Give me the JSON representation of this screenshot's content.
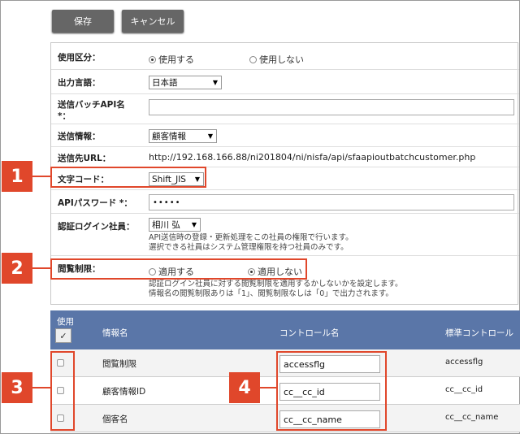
{
  "toolbar": {
    "save_label": "保存",
    "cancel_label": "キャンセル"
  },
  "form": {
    "usage": {
      "label": "使用区分：",
      "options": [
        "使用する",
        "使用しない"
      ],
      "selected": "使用する"
    },
    "language": {
      "label": "出力言語：",
      "value": "日本語"
    },
    "batch_api": {
      "label_line1": "送信バッチAPI名",
      "label_line2": "*：",
      "value": ""
    },
    "send_info": {
      "label": "送信情報：",
      "value": "顧客情報"
    },
    "url": {
      "label": "送信先URL：",
      "value": "http://192.168.166.88/ni201804/ni/nisfa/api/sfaapioutbatchcustomer.php"
    },
    "charset": {
      "label": "文字コード：",
      "value": "Shift_JIS"
    },
    "api_password": {
      "label": "APIパスワード *：",
      "value": "•••••"
    },
    "auth_user": {
      "label": "認証ログイン社員：",
      "value": "相川 弘",
      "note_line1": "API送信時の登録・更新処理をこの社員の権限で行います。",
      "note_line2": "選択できる社員はシステム管理権限を持つ社員のみです。"
    },
    "view_restrict": {
      "label": "閲覧制限：",
      "options": [
        "適用する",
        "適用しない"
      ],
      "selected": "適用しない",
      "note_line1": "認証ログイン社員に対する閲覧制限を適用するかしないかを設定します。",
      "note_line2": "情報名の閲覧制限ありは「1」、閲覧制限なしは「0」で出力されます。"
    }
  },
  "table": {
    "headers": {
      "use": "使用",
      "info_name": "情報名",
      "control_name": "コントロール名",
      "std_control": "標準コントロール"
    },
    "checkall_glyph": "✓",
    "rows": [
      {
        "info_name": "閲覧制限",
        "control_name": "accessflg",
        "std_control": "accessflg"
      },
      {
        "info_name": "顧客情報ID",
        "control_name": "cc__cc_id",
        "std_control": "cc__cc_id"
      },
      {
        "info_name": "個客名",
        "control_name": "cc__cc_name",
        "std_control": "cc__cc_name"
      }
    ]
  },
  "callouts": [
    "1",
    "2",
    "3",
    "4"
  ],
  "colors": {
    "accent": "#e0472b",
    "table_header": "#5a76a8",
    "button": "#666666"
  }
}
